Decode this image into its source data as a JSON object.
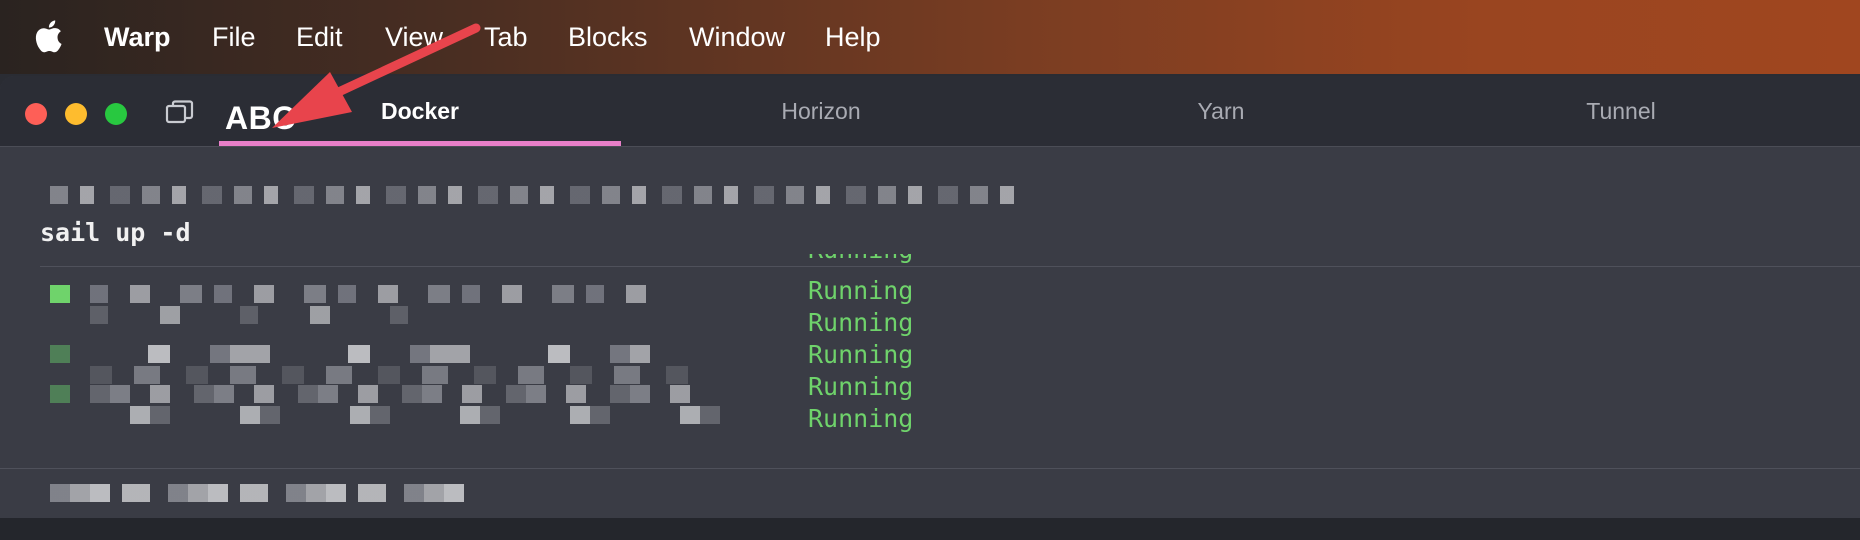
{
  "menubar": {
    "app_name": "Warp",
    "items": [
      "File",
      "Edit",
      "View",
      "Tab",
      "Blocks",
      "Window",
      "Help"
    ]
  },
  "tabs": [
    {
      "label": "Docker",
      "active": true
    },
    {
      "label": "Horizon",
      "active": false
    },
    {
      "label": "Yarn",
      "active": false
    },
    {
      "label": "Tunnel",
      "active": false
    }
  ],
  "annotation": {
    "label": "ABC",
    "arrow_color": "#e8444c"
  },
  "terminal": {
    "command": "sail up -d",
    "statuses": [
      "Running",
      "Running",
      "Running",
      "Running",
      "Running",
      "Running"
    ]
  },
  "colors": {
    "accent_underline": "#e87fc9",
    "status_green": "#6fd36b",
    "traffic_close": "#fe5f57",
    "traffic_minimize": "#febc2e",
    "traffic_zoom": "#28c840"
  },
  "icons": {
    "apple": "apple-logo-icon",
    "tabs": "tab-overview-icon"
  }
}
